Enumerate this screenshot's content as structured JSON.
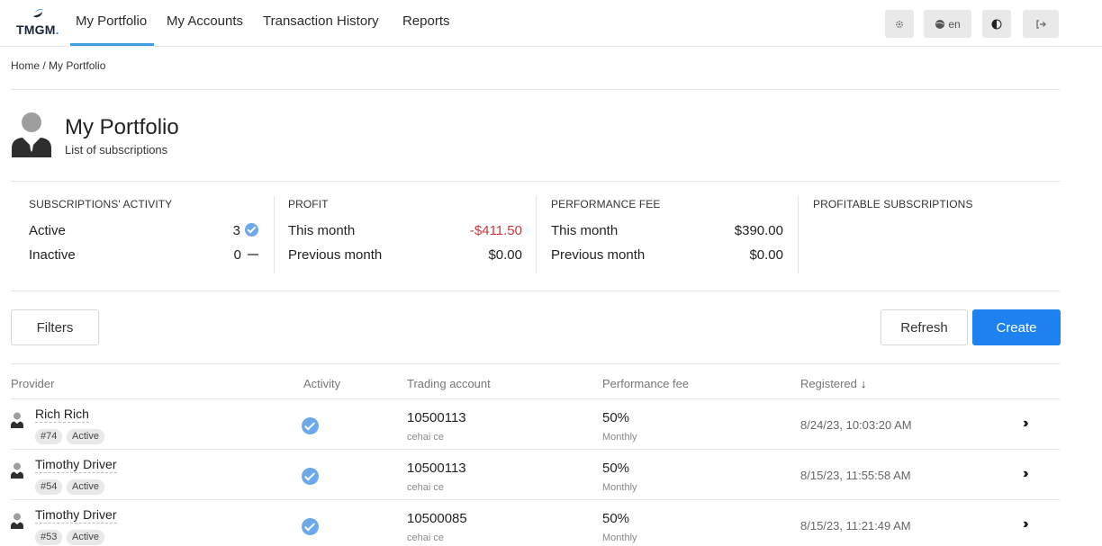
{
  "brand": {
    "name": "TMGM",
    "dot": "."
  },
  "nav": {
    "links": [
      "My Portfolio",
      "My Accounts",
      "Transaction History",
      "Reports"
    ],
    "icons": {
      "settings": "gear-icon",
      "language": "globe-icon",
      "language_label": "en",
      "theme": "contrast-icon",
      "logout": "logout-icon"
    }
  },
  "breadcrumb": {
    "home": "Home",
    "separator": "/",
    "current": "My Portfolio"
  },
  "header": {
    "title": "My Portfolio",
    "subtitle": "List of subscriptions"
  },
  "stats": {
    "activity": {
      "heading": "Subscriptions' activity",
      "active_label": "Active",
      "active_value": "3",
      "inactive_label": "Inactive",
      "inactive_value": "0"
    },
    "profit": {
      "heading": "Profit",
      "this_month_label": "This month",
      "this_month_value": "-$411.50",
      "prev_month_label": "Previous month",
      "prev_month_value": "$0.00"
    },
    "fee": {
      "heading": "Performance fee",
      "this_month_label": "This month",
      "this_month_value": "$390.00",
      "prev_month_label": "Previous month",
      "prev_month_value": "$0.00"
    },
    "profitable": {
      "heading": "Profitable subscriptions"
    }
  },
  "toolbar": {
    "filters": "Filters",
    "refresh": "Refresh",
    "create": "Create"
  },
  "table": {
    "headers": {
      "provider": "Provider",
      "activity": "Activity",
      "account": "Trading account",
      "fee": "Performance fee",
      "registered": "Registered"
    },
    "rows": [
      {
        "name": "Rich Rich",
        "id": "#74",
        "status": "Active",
        "account": "10500113",
        "account_name": "cehai ce",
        "fee": "50%",
        "period": "Monthly",
        "registered": "8/24/23, 10:03:20 AM"
      },
      {
        "name": "Timothy Driver",
        "id": "#54",
        "status": "Active",
        "account": "10500113",
        "account_name": "cehai ce",
        "fee": "50%",
        "period": "Monthly",
        "registered": "8/15/23, 11:55:58 AM"
      },
      {
        "name": "Timothy Driver",
        "id": "#53",
        "status": "Active",
        "account": "10500085",
        "account_name": "cehai ce",
        "fee": "50%",
        "period": "Monthly",
        "registered": "8/15/23, 11:21:49 AM"
      }
    ]
  },
  "colors": {
    "accent": "#1d82f0",
    "nav_underline": "#3fa0df",
    "negative": "#c9393f",
    "check": "#6aa9ea"
  }
}
